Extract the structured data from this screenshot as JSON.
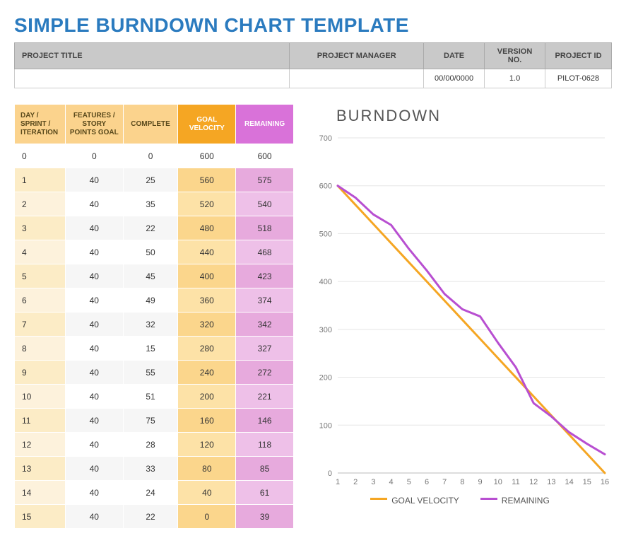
{
  "title": "SIMPLE BURNDOWN CHART TEMPLATE",
  "meta": {
    "headers": {
      "project_title": "PROJECT TITLE",
      "project_manager": "PROJECT MANAGER",
      "date": "DATE",
      "version": "VERSION NO.",
      "project_id": "PROJECT ID"
    },
    "values": {
      "project_title": "",
      "project_manager": "",
      "date": "00/00/0000",
      "version": "1.0",
      "project_id": "PILOT-0628"
    }
  },
  "table": {
    "headers": {
      "day": "DAY / SPRINT / ITERATION",
      "goal": "FEATURES / STORY POINTS GOAL",
      "complete": "COMPLETE",
      "velocity": "GOAL VELOCITY",
      "remaining": "REMAINING"
    },
    "rows": [
      {
        "day": "0",
        "goal": "0",
        "complete": "0",
        "velocity": "600",
        "remaining": "600"
      },
      {
        "day": "1",
        "goal": "40",
        "complete": "25",
        "velocity": "560",
        "remaining": "575"
      },
      {
        "day": "2",
        "goal": "40",
        "complete": "35",
        "velocity": "520",
        "remaining": "540"
      },
      {
        "day": "3",
        "goal": "40",
        "complete": "22",
        "velocity": "480",
        "remaining": "518"
      },
      {
        "day": "4",
        "goal": "40",
        "complete": "50",
        "velocity": "440",
        "remaining": "468"
      },
      {
        "day": "5",
        "goal": "40",
        "complete": "45",
        "velocity": "400",
        "remaining": "423"
      },
      {
        "day": "6",
        "goal": "40",
        "complete": "49",
        "velocity": "360",
        "remaining": "374"
      },
      {
        "day": "7",
        "goal": "40",
        "complete": "32",
        "velocity": "320",
        "remaining": "342"
      },
      {
        "day": "8",
        "goal": "40",
        "complete": "15",
        "velocity": "280",
        "remaining": "327"
      },
      {
        "day": "9",
        "goal": "40",
        "complete": "55",
        "velocity": "240",
        "remaining": "272"
      },
      {
        "day": "10",
        "goal": "40",
        "complete": "51",
        "velocity": "200",
        "remaining": "221"
      },
      {
        "day": "11",
        "goal": "40",
        "complete": "75",
        "velocity": "160",
        "remaining": "146"
      },
      {
        "day": "12",
        "goal": "40",
        "complete": "28",
        "velocity": "120",
        "remaining": "118"
      },
      {
        "day": "13",
        "goal": "40",
        "complete": "33",
        "velocity": "80",
        "remaining": "85"
      },
      {
        "day": "14",
        "goal": "40",
        "complete": "24",
        "velocity": "40",
        "remaining": "61"
      },
      {
        "day": "15",
        "goal": "40",
        "complete": "22",
        "velocity": "0",
        "remaining": "39"
      }
    ]
  },
  "chart_title": "BURNDOWN",
  "legend": {
    "velocity": "GOAL VELOCITY",
    "remaining": "REMAINING"
  },
  "colors": {
    "velocity": "#f5a623",
    "remaining": "#b84fd1",
    "grid": "#e5e5e5",
    "axis": "#bbb",
    "tick_text": "#777"
  },
  "chart_data": {
    "type": "line",
    "title": "BURNDOWN",
    "xlabel": "",
    "ylabel": "",
    "x": [
      1,
      2,
      3,
      4,
      5,
      6,
      7,
      8,
      9,
      10,
      11,
      12,
      13,
      14,
      15,
      16
    ],
    "y_ticks": [
      0,
      100,
      200,
      300,
      400,
      500,
      600,
      700
    ],
    "ylim": [
      0,
      700
    ],
    "series": [
      {
        "name": "GOAL VELOCITY",
        "color": "#f5a623",
        "values": [
          600,
          560,
          520,
          480,
          440,
          400,
          360,
          320,
          280,
          240,
          200,
          160,
          120,
          80,
          40,
          0
        ]
      },
      {
        "name": "REMAINING",
        "color": "#b84fd1",
        "values": [
          600,
          575,
          540,
          518,
          468,
          423,
          374,
          342,
          327,
          272,
          221,
          146,
          118,
          85,
          61,
          39
        ]
      }
    ],
    "legend_position": "bottom",
    "grid": "horizontal"
  }
}
